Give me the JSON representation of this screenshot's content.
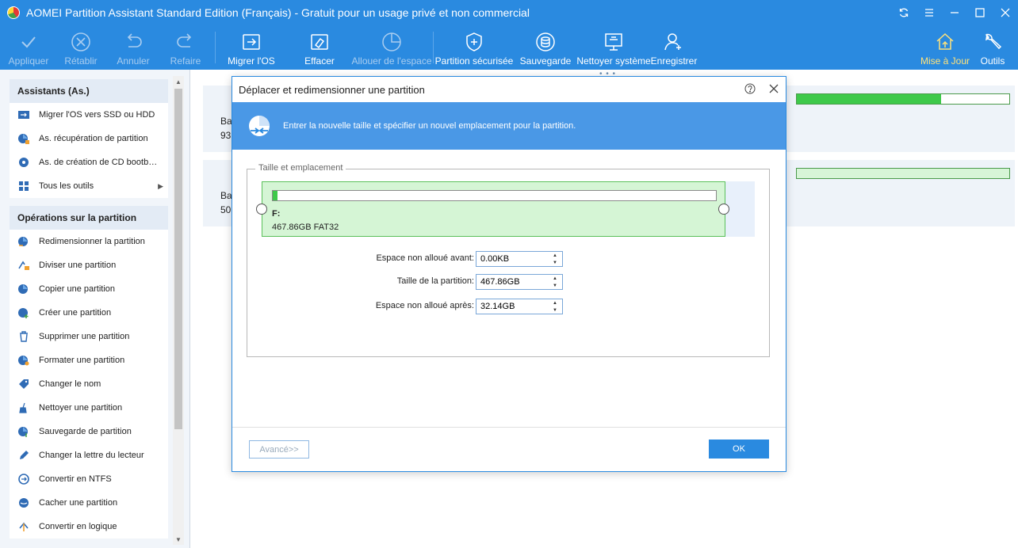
{
  "window": {
    "title": "AOMEI Partition Assistant Standard Edition (Français) - Gratuit pour un usage privé et non commercial"
  },
  "toolbar": {
    "apply": "Appliquer",
    "redo": "Rétablir",
    "undo": "Annuler",
    "retry": "Refaire",
    "migrate_os": "Migrer l'OS",
    "wipe": "Effacer",
    "allocate": "Allouer de l'espace",
    "secure_partition": "Partition sécurisée",
    "backup": "Sauvegarde",
    "clean_system": "Nettoyer système",
    "register": "Enregistrer",
    "update": "Mise à Jour",
    "tools": "Outils"
  },
  "sidebar": {
    "wizards_header": "Assistants (As.)",
    "wizards": [
      {
        "label": "Migrer l'OS vers SSD ou HDD",
        "icon": "migrate-disk-icon"
      },
      {
        "label": "As. récupération de partition",
        "icon": "pie-recovery-icon"
      },
      {
        "label": "As. de création de CD bootb…",
        "icon": "cd-icon"
      },
      {
        "label": "Tous les outils",
        "icon": "grid-icon"
      }
    ],
    "operations_header": "Opérations sur la partition",
    "operations": [
      {
        "label": "Redimensionner la partition",
        "icon": "resize-icon"
      },
      {
        "label": "Diviser une partition",
        "icon": "split-icon"
      },
      {
        "label": "Copier une partition",
        "icon": "copy-icon"
      },
      {
        "label": "Créer une partition",
        "icon": "create-icon"
      },
      {
        "label": "Supprimer une partition",
        "icon": "trash-icon"
      },
      {
        "label": "Formater une partition",
        "icon": "format-icon"
      },
      {
        "label": "Changer le nom",
        "icon": "tag-icon"
      },
      {
        "label": "Nettoyer une partition",
        "icon": "broom-icon"
      },
      {
        "label": "Sauvegarde de partition",
        "icon": "backup-icon"
      },
      {
        "label": "Changer la lettre du lecteur",
        "icon": "pen-icon"
      },
      {
        "label": "Convertir en NTFS",
        "icon": "convert-icon"
      },
      {
        "label": "Cacher une partition",
        "icon": "hide-icon"
      },
      {
        "label": "Convertir en logique",
        "icon": "logical-icon"
      }
    ]
  },
  "disks": [
    {
      "line1": "Ba",
      "line2": "93",
      "used": 0.68
    },
    {
      "line1": "Ba",
      "line2": "50",
      "used": 0.0
    }
  ],
  "dialog": {
    "title": "Déplacer et redimensionner une partition",
    "banner_text": "Entrer la nouvelle taille et spécifier un nouvel emplacement pour la partition.",
    "group_title": "Taille et emplacement",
    "partition": {
      "letter": "F:",
      "info": "467.86GB FAT32",
      "used_fraction": 0.01
    },
    "fields": {
      "before_label": "Espace non alloué avant:",
      "before_value": "0.00KB",
      "size_label": "Taille de la partition:",
      "size_value": "467.86GB",
      "after_label": "Espace non alloué après:",
      "after_value": "32.14GB"
    },
    "advanced": "Avancé>>",
    "ok": "OK"
  },
  "colors": {
    "accent": "#2a8ae0",
    "partition_fill": "#d5f5d5",
    "used_bar": "#3ec94a"
  }
}
